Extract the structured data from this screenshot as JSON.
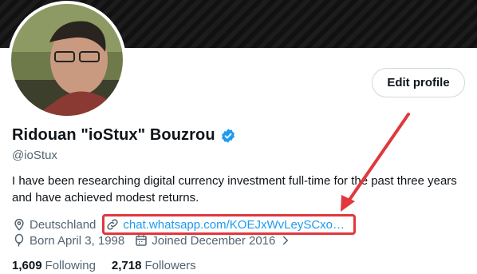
{
  "profile": {
    "display_name": "Ridouan \"ioStux\" Bouzrou",
    "handle": "@ioStux",
    "bio": "I have been researching digital currency investment full-time for the past three years and have achieved modest returns.",
    "location": "Deutschland",
    "link": "chat.whatsapp.com/KOEJxWvLeySCxo…",
    "birthday": "Born April 3, 1998",
    "joined": "Joined December 2016"
  },
  "actions": {
    "edit_profile": "Edit profile"
  },
  "stats": {
    "following_count": "1,609",
    "following_label": "Following",
    "followers_count": "2,718",
    "followers_label": "Followers"
  },
  "colors": {
    "accent": "#1d9bf0",
    "annotation": "#e0383e",
    "muted_text": "#536471"
  },
  "icons": {
    "verified": "verified-badge-icon",
    "location": "location-pin-icon",
    "link": "link-icon",
    "birthday": "balloon-icon",
    "joined": "calendar-icon"
  }
}
